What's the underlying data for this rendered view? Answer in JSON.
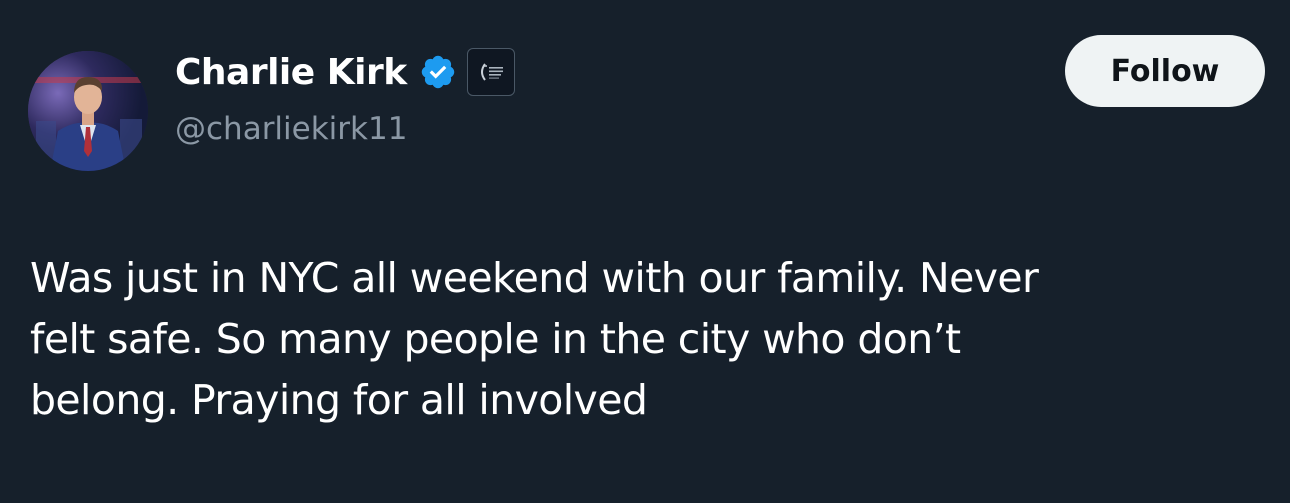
{
  "user": {
    "display_name": "Charlie Kirk",
    "handle": "@charliekirk11",
    "verified_icon": "verified-check-icon",
    "affiliate_icon": "turning-point-usa-logo",
    "avatar": "profile-photo"
  },
  "actions": {
    "follow_label": "Follow"
  },
  "tweet": {
    "lines": [
      "Was just in NYC all weekend with our family. Never",
      "felt safe. So many people in the city who don’t",
      "belong. Praying for all involved"
    ]
  },
  "colors": {
    "background": "#16202b",
    "verified_blue": "#1d9bf0",
    "handle_gray": "#8b98a5",
    "follow_bg": "#eff3f4"
  }
}
